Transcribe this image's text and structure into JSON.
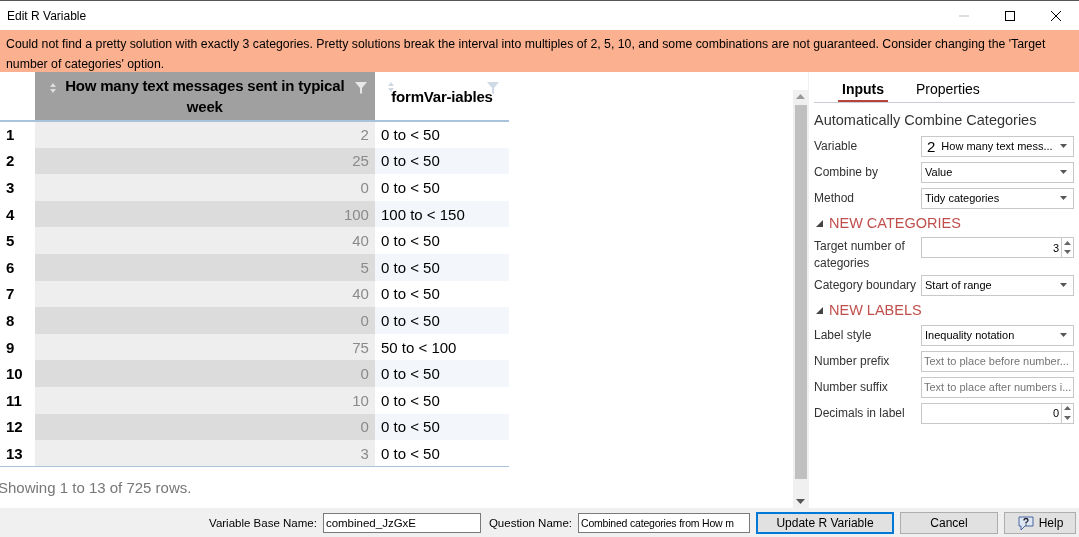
{
  "window": {
    "title": "Edit R Variable"
  },
  "banner": "Could not find a pretty solution with exactly 3 categories. Pretty solutions break the interval into multiples of 2, 5, 10, and some combinations are not guaranteed. Consider changing the 'Target number of categories' option.",
  "table": {
    "columns": [
      {
        "label": "How many text messages sent in typical week",
        "selected": true
      },
      {
        "label": "formVar-iables",
        "selected": false
      }
    ],
    "rows": [
      {
        "index": "1",
        "value": "2",
        "category": "0 to < 50"
      },
      {
        "index": "2",
        "value": "25",
        "category": "0 to < 50"
      },
      {
        "index": "3",
        "value": "0",
        "category": "0 to < 50"
      },
      {
        "index": "4",
        "value": "100",
        "category": "100 to < 150"
      },
      {
        "index": "5",
        "value": "40",
        "category": "0 to < 50"
      },
      {
        "index": "6",
        "value": "5",
        "category": "0 to < 50"
      },
      {
        "index": "7",
        "value": "40",
        "category": "0 to < 50"
      },
      {
        "index": "8",
        "value": "0",
        "category": "0 to < 50"
      },
      {
        "index": "9",
        "value": "75",
        "category": "50 to < 100"
      },
      {
        "index": "10",
        "value": "0",
        "category": "0 to < 50"
      },
      {
        "index": "11",
        "value": "10",
        "category": "0 to < 50"
      },
      {
        "index": "12",
        "value": "0",
        "category": "0 to < 50"
      },
      {
        "index": "13",
        "value": "3",
        "category": "0 to < 50"
      }
    ],
    "footer": "Showing 1 to 13 of 725 rows."
  },
  "panel": {
    "tabs": [
      {
        "label": "Inputs",
        "selected": true
      },
      {
        "label": "Properties",
        "selected": false
      }
    ],
    "heading": "Automatically Combine Categories",
    "fields": [
      {
        "kind": "dropdown",
        "label": "Variable",
        "prefix": "2",
        "value": "How many text mess..."
      },
      {
        "kind": "dropdown",
        "label": "Combine by",
        "value": "Value"
      },
      {
        "kind": "dropdown",
        "label": "Method",
        "value": "Tidy categories"
      },
      {
        "kind": "section",
        "label": "NEW CATEGORIES"
      },
      {
        "kind": "spinner",
        "label": "Target number of categories",
        "value": "3"
      },
      {
        "kind": "dropdown",
        "label": "Category boundary",
        "value": "Start of range"
      },
      {
        "kind": "section",
        "label": "NEW LABELS"
      },
      {
        "kind": "dropdown",
        "label": "Label style",
        "value": "Inequality notation"
      },
      {
        "kind": "text",
        "label": "Number prefix",
        "placeholder": "Text to place before number..."
      },
      {
        "kind": "text",
        "label": "Number suffix",
        "placeholder": "Text to place after numbers i..."
      },
      {
        "kind": "spinner",
        "label": "Decimals in label",
        "value": "0"
      }
    ]
  },
  "bottom_bar": {
    "base_name_label": "Variable Base Name:",
    "base_name": "combined_JzGxE",
    "question_label": "Question Name:",
    "question_name": "Combined categories from How m",
    "buttons": [
      "Update R Variable",
      "Cancel",
      "Help"
    ]
  }
}
